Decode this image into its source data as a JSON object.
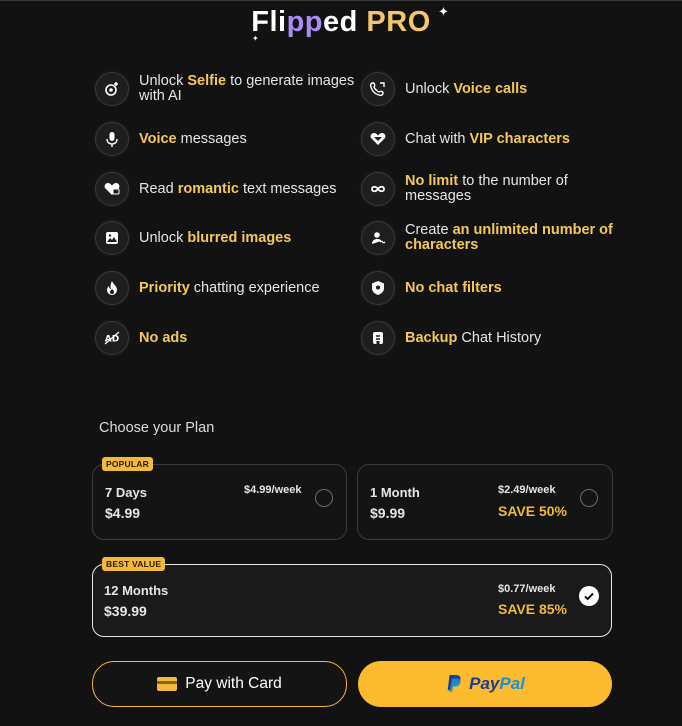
{
  "title": {
    "part1": "Fli",
    "part2": "pp",
    "part3": "ed ",
    "part4": "PRO"
  },
  "features": [
    {
      "icon": "selfie-icon",
      "t1": "Unlock ",
      "t2": "Selfie",
      "t3": " to generate images with AI"
    },
    {
      "icon": "phone-icon",
      "t1": "Unlock ",
      "t2": "Voice calls",
      "t3": ""
    },
    {
      "icon": "microphone-icon",
      "t1": "",
      "t2": "Voice",
      "t3": " messages"
    },
    {
      "icon": "vip-heart-icon",
      "t1": "Chat with ",
      "t2": "VIP characters",
      "t3": ""
    },
    {
      "icon": "heart-message-icon",
      "t1": "Read ",
      "t2": "romantic",
      "t3": " text messages"
    },
    {
      "icon": "infinity-icon",
      "t1": "",
      "t2": "No limit",
      "t3": " to the number of messages"
    },
    {
      "icon": "image-icon",
      "t1": "Unlock ",
      "t2": "blurred images",
      "t3": ""
    },
    {
      "icon": "add-character-icon",
      "t1": "Create ",
      "t2": "an unlimited number of characters",
      "t3": ""
    },
    {
      "icon": "fire-icon",
      "t1": "",
      "t2": "Priority",
      "t3": " chatting experience"
    },
    {
      "icon": "shield-icon",
      "t1": "",
      "t2": "No chat filters",
      "t3": ""
    },
    {
      "icon": "no-ads-icon",
      "t1": "",
      "t2": "No ads",
      "t3": ""
    },
    {
      "icon": "backup-icon",
      "t1": "",
      "t2": "Backup",
      "t3": " Chat History"
    }
  ],
  "plans": {
    "header": "Choose your Plan",
    "items": [
      {
        "badge": "POPULAR",
        "name": "7 Days",
        "price": "$4.99",
        "weekly": "$4.99/week",
        "save": "",
        "selected": false
      },
      {
        "badge": "",
        "name": "1 Month",
        "price": "$9.99",
        "weekly": "$2.49/week",
        "save": "SAVE 50%",
        "selected": false
      },
      {
        "badge": "BEST VALUE",
        "name": "12 Months",
        "price": "$39.99",
        "weekly": "$0.77/week",
        "save": "SAVE 85%",
        "selected": true
      }
    ]
  },
  "buttons": {
    "card_label": "Pay with Card",
    "paypal_part1": "Pay",
    "paypal_part2": "Pal"
  },
  "colors": {
    "accent": "#f2b93b",
    "highlight": "#f5c75a",
    "purple": "#a98cf5",
    "background": "#121212"
  }
}
